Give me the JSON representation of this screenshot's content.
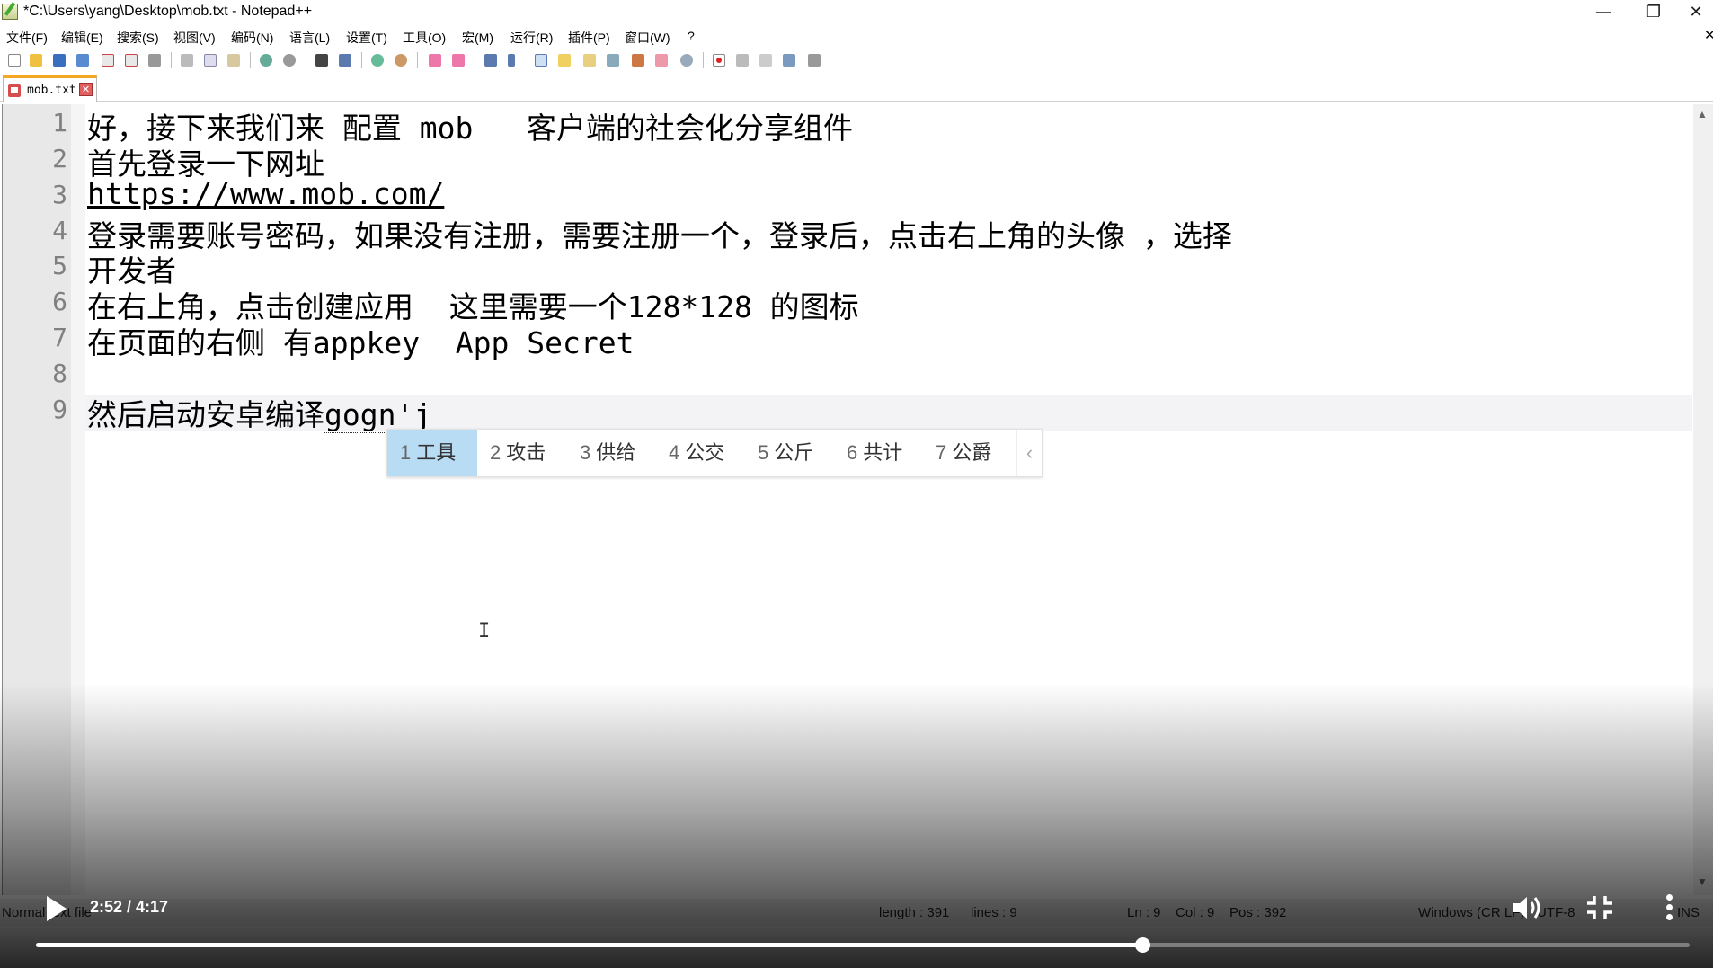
{
  "window": {
    "title": "*C:\\Users\\yang\\Desktop\\mob.txt - Notepad++",
    "minimize_glyph": "—",
    "restore_glyph": "❐",
    "close_glyph": "✕",
    "far_close_glyph": "✕"
  },
  "menu": {
    "items": [
      "文件(F)",
      "编辑(E)",
      "搜索(S)",
      "视图(V)",
      "编码(N)",
      "语言(L)",
      "设置(T)",
      "工具(O)",
      "宏(M)",
      "运行(R)",
      "插件(P)",
      "窗口(W)",
      "?"
    ]
  },
  "toolbar": {
    "icons": [
      "new-file-icon",
      "open-file-icon",
      "save-icon",
      "save-all-icon",
      "close-icon",
      "close-all-icon",
      "print-icon",
      "cut-icon",
      "copy-icon",
      "paste-icon",
      "undo-icon",
      "redo-icon",
      "find-icon",
      "replace-icon",
      "zoom-in-icon",
      "zoom-out-icon",
      "sync-vertical-icon",
      "sync-horizontal-icon",
      "word-wrap-icon",
      "show-all-chars-icon",
      "indent-guide-icon",
      "user-lang-icon",
      "doc-map-icon",
      "function-list-icon",
      "folder-workspace-icon",
      "monitoring-icon",
      "macro-record-icon",
      "macro-stop-icon",
      "macro-play-icon",
      "macro-run-multiple-icon",
      "macro-save-icon"
    ]
  },
  "tab": {
    "label": "mob.txt",
    "close_glyph": "✕"
  },
  "editor": {
    "lines": [
      {
        "num": "1",
        "text": "好，接下来我们来 配置 mob   客户端的社会化分享组件"
      },
      {
        "num": "2",
        "text": "首先登录一下网址"
      },
      {
        "num": "3",
        "text": "https://www.mob.com/"
      },
      {
        "num": "4",
        "text": "登录需要账号密码，如果没有注册，需要注册一个，登录后，点击右上角的头像 ，选择"
      },
      {
        "num": "5",
        "text": "开发者"
      },
      {
        "num": "6",
        "text": "在右上角，点击创建应用  这里需要一个128*128 的图标"
      },
      {
        "num": "7",
        "text": "在页面的右侧 有appkey  App Secret"
      },
      {
        "num": "8",
        "text": ""
      },
      {
        "num": "9",
        "text": "然后启动安卓编译"
      }
    ],
    "composition_text": "gogn'j",
    "cursor_glyph": "I"
  },
  "ime": {
    "candidates": [
      {
        "num": "1",
        "text": "工具"
      },
      {
        "num": "2",
        "text": "攻击"
      },
      {
        "num": "3",
        "text": "供给"
      },
      {
        "num": "4",
        "text": "公交"
      },
      {
        "num": "5",
        "text": "公斤"
      },
      {
        "num": "6",
        "text": "共计"
      },
      {
        "num": "7",
        "text": "公爵"
      }
    ],
    "selected_index": 0,
    "prev_page_glyph": "‹"
  },
  "statusbar": {
    "file_type": "Normal text file",
    "length": "length : 391",
    "lines": "lines : 9",
    "ln": "Ln : 9",
    "col": "Col : 9",
    "pos": "Pos : 392",
    "eol": "Windows (CR LF)",
    "encoding": "UTF-8",
    "mode": "INS"
  },
  "video": {
    "time": "2:52 / 4:17",
    "progress": 0.669
  },
  "colors": {
    "tab_accent": "#f5a623",
    "ime_selected": "#b9dcf5",
    "gutter": "#e8e8e8"
  }
}
